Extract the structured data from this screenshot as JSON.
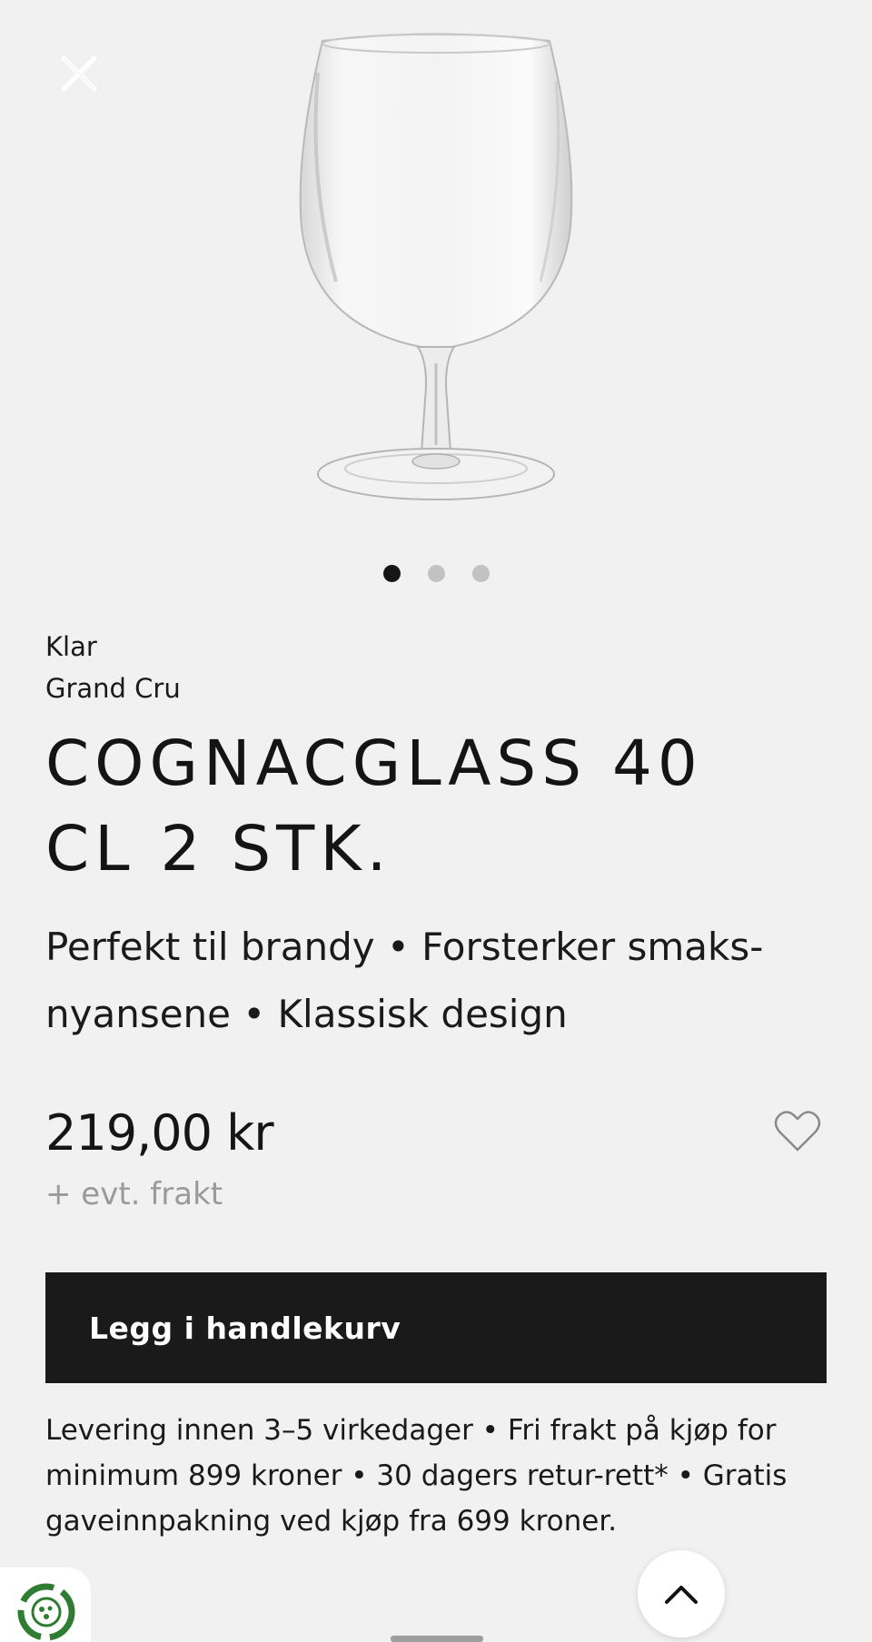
{
  "product": {
    "color": "Klar",
    "series": "Grand Cru",
    "title": "COGNACGLASS 40 CL 2 STK.",
    "features": "Perfekt til brandy • Forsterker smaks-nyansene • Klassisk design",
    "price": "219,00 kr",
    "shipping_note": "+ evt. frakt"
  },
  "gallery": {
    "image_count": 3,
    "active_index": 0
  },
  "actions": {
    "add_to_cart_label": "Legg i handlekurv"
  },
  "info": {
    "text": "Levering innen 3–5 virkedager • Fri frakt på kjøp for minimum 899 kroner • 30 dagers retur-rett* • Gratis gaveinnpakning ved kjøp fra 699 kroner."
  },
  "icons": {
    "close": "close-icon",
    "favorite": "heart-icon",
    "scroll_top": "chevron-up-icon",
    "eco": "recycle-badge-icon"
  },
  "colors": {
    "background": "#f1f1f1",
    "button": "#1a1a1a",
    "button_text": "#ffffff",
    "muted": "#9a9a9a",
    "eco_green": "#2e7d32"
  }
}
